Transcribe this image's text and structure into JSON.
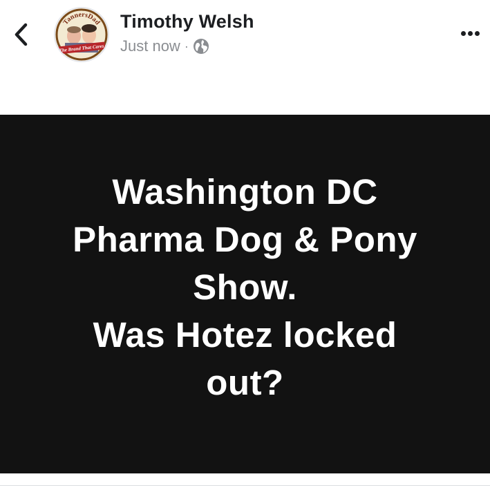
{
  "post": {
    "author": {
      "name": "Timothy Welsh",
      "avatar_alt": "TannersDad The Brand That Cares",
      "avatar_text_top": "TannersDad",
      "avatar_text_banner": "The Brand That Cares"
    },
    "timestamp": "Just now",
    "separator": "·",
    "audience_icon": "globe-icon",
    "text_lines": [
      "Washington DC",
      "Pharma Dog & Pony",
      "Show.",
      "Was Hotez locked",
      "out?"
    ],
    "background_color": "#121212",
    "text_color": "#ffffff"
  },
  "nav": {
    "back_icon": "chevron-left-icon",
    "more_icon": "ellipsis-icon"
  }
}
